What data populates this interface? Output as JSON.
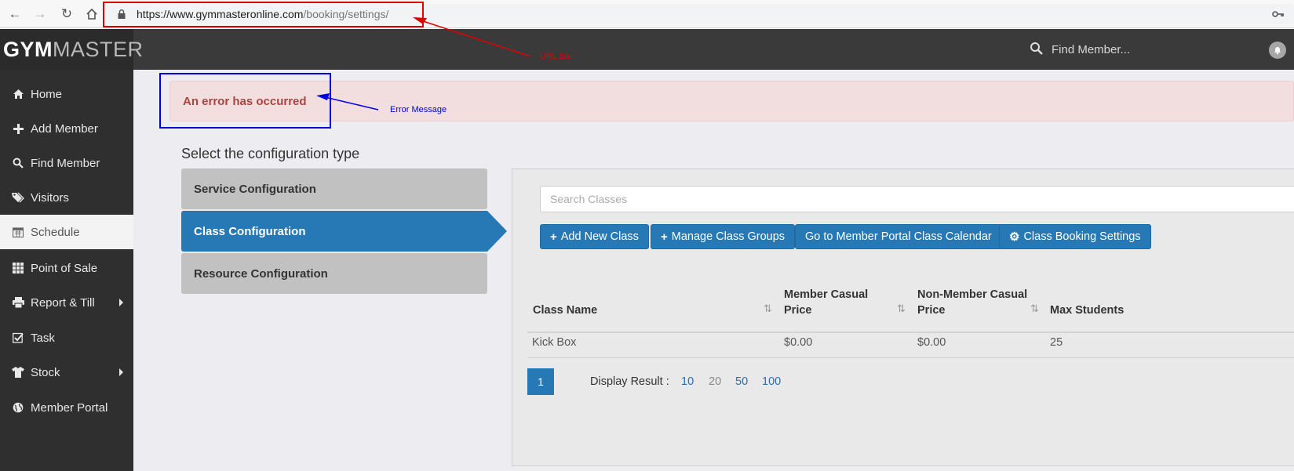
{
  "browser": {
    "url_host": "https://www.gymmasteronline.com",
    "url_path": "/booking/settings/"
  },
  "header": {
    "logo_gym": "GYM",
    "logo_master": "MASTER",
    "search_placeholder": "Find Member..."
  },
  "sidebar": {
    "items": [
      {
        "label": "Home",
        "icon": "home-icon"
      },
      {
        "label": "Add Member",
        "icon": "plus-icon"
      },
      {
        "label": "Find Member",
        "icon": "search-icon"
      },
      {
        "label": "Visitors",
        "icon": "tags-icon"
      },
      {
        "label": "Schedule",
        "icon": "calendar-icon",
        "active": true
      },
      {
        "label": "Point of Sale",
        "icon": "grid-icon"
      },
      {
        "label": "Report & Till",
        "icon": "print-icon",
        "submenu": true
      },
      {
        "label": "Task",
        "icon": "check-square-icon"
      },
      {
        "label": "Stock",
        "icon": "tshirt-icon",
        "submenu": true
      },
      {
        "label": "Member Portal",
        "icon": "globe-icon"
      }
    ]
  },
  "main": {
    "error_message": "An error has occurred",
    "section_title": "Select the configuration type",
    "config_tabs": [
      {
        "label": "Service Configuration",
        "active": false
      },
      {
        "label": "Class Configuration",
        "active": true
      },
      {
        "label": "Resource Configuration",
        "active": false
      }
    ],
    "search_placeholder": "Search Classes",
    "buttons": {
      "add_new_class": "Add New Class",
      "manage_class_groups": "Manage Class Groups",
      "member_portal_calendar": "Go to Member Portal Class Calendar",
      "class_booking_settings": "Class Booking Settings"
    },
    "table": {
      "columns": [
        {
          "line1": "Class Name",
          "line2": ""
        },
        {
          "line1": "Member Casual",
          "line2": "Price"
        },
        {
          "line1": "Non-Member Casual",
          "line2": "Price"
        },
        {
          "line1": "Max Students",
          "line2": ""
        }
      ],
      "rows": [
        {
          "class_name": "Kick Box",
          "member_price": "$0.00",
          "non_member_price": "$0.00",
          "max_students": "25"
        }
      ]
    },
    "pagination": {
      "current_page": "1",
      "display_label": "Display Result :",
      "page_sizes": [
        "10",
        "20",
        "50",
        "100"
      ],
      "selected_size": "20"
    }
  },
  "annotations": {
    "url_bar_label": "URL Bar",
    "error_label": "Error Message",
    "colors": {
      "url": "#e00000",
      "error": "#0000dd"
    }
  }
}
